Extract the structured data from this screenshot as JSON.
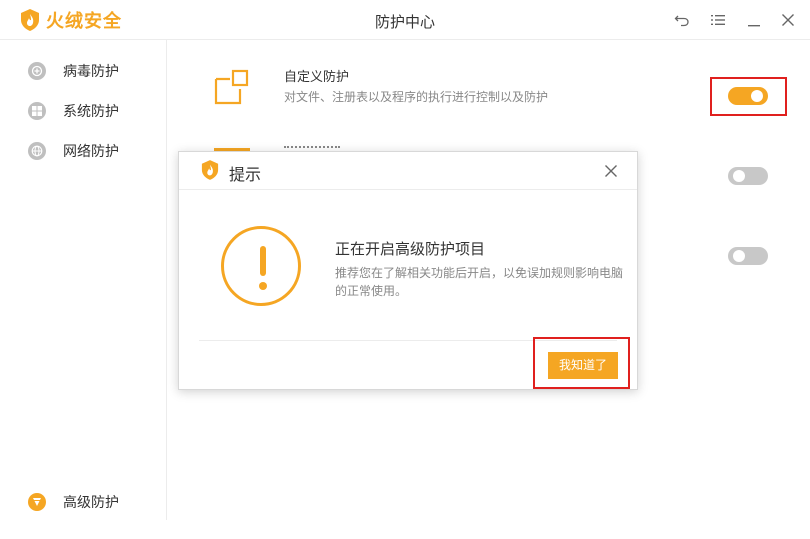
{
  "app": {
    "brand_name": "火绒安全",
    "window_title": "防护中心",
    "controls": {
      "back_icon": "undo-icon",
      "menu_icon": "menu-icon",
      "minimize_icon": "minimize-icon",
      "close_icon": "close-icon"
    }
  },
  "sidebar": {
    "items": [
      {
        "label": "病毒防护",
        "icon": "virus-shield-icon",
        "active": false
      },
      {
        "label": "系统防护",
        "icon": "windows-icon",
        "active": false
      },
      {
        "label": "网络防护",
        "icon": "globe-icon",
        "active": false
      },
      {
        "label": "高级防护",
        "icon": "advanced-shield-icon",
        "active": true
      }
    ]
  },
  "main": {
    "rows": [
      {
        "title": "自定义防护",
        "description": "对文件、注册表以及程序的执行进行控制以及防护",
        "enabled": true
      },
      {
        "title": "",
        "description": "",
        "enabled": false
      },
      {
        "title": "",
        "description": "",
        "enabled": false
      }
    ]
  },
  "dialog": {
    "title": "提示",
    "heading": "正在开启高级防护项目",
    "body": "推荐您在了解相关功能后开启，以免误加规则影响电脑的正常使用。",
    "ok_label": "我知道了"
  },
  "colors": {
    "accent": "#f5a623",
    "highlight": "#e0201e",
    "toggle_off": "#c8c8c8"
  }
}
